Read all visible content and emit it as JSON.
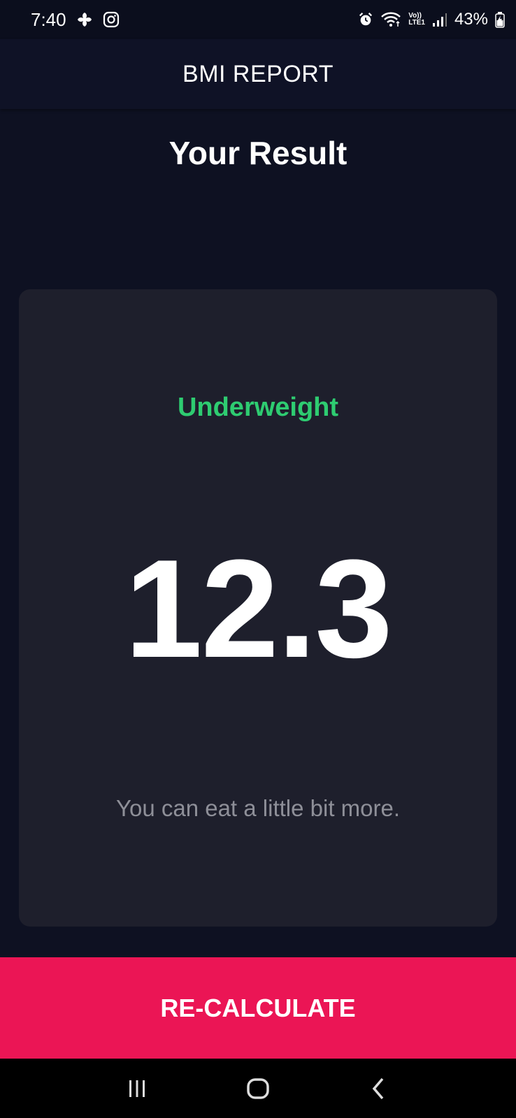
{
  "status_bar": {
    "time": "7:40",
    "volte_top": "Vo))",
    "volte_bottom": "LTE1",
    "battery_percent": "43%",
    "icons": [
      "pinwheel-icon",
      "instagram-icon",
      "alarm-icon",
      "wifi-icon",
      "volte-icon",
      "signal-icon",
      "battery-charging-icon"
    ]
  },
  "app_bar": {
    "title": "BMI REPORT"
  },
  "page": {
    "title": "Your Result"
  },
  "result": {
    "status": "Underweight",
    "bmi_value": "12.3",
    "message": "You can eat a little bit more."
  },
  "actions": {
    "recalculate_label": "RE-CALCULATE"
  },
  "nav_bar": {
    "icons": [
      "recent-apps-icon",
      "home-icon",
      "back-icon"
    ]
  },
  "colors": {
    "background": "#0e1122",
    "card": "#1e1f2c",
    "status_green": "#2ecc71",
    "accent_pink": "#eb1555",
    "message_gray": "#8e8f98"
  }
}
